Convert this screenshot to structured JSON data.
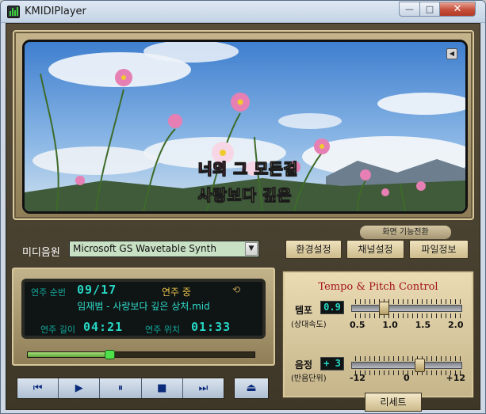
{
  "window": {
    "title": "KMIDIPlayer",
    "minimize_glyph": "—",
    "maximize_glyph": "□",
    "close_glyph": "✕"
  },
  "video": {
    "lyric_line1_sung": "너의 그",
    "lyric_line1_rest": " 모든걸",
    "lyric_line2": "사랑보다 깊은",
    "screen_toggle_label": "화면 기능전환",
    "corner_icon": "back-arrow-icon"
  },
  "source": {
    "label": "미디음원",
    "selected": "Microsoft GS Wavetable Synth",
    "buttons": {
      "env": "환경설정",
      "channel": "채널설정",
      "fileinfo": "파일정보"
    }
  },
  "player": {
    "order_label": "연주 순번",
    "order_value": "09/17",
    "state": "연주 중",
    "filename": "임재범 - 사랑보다 깊은 상처.mid",
    "length_label": "연주 길이",
    "length_value": "04:21",
    "position_label": "연주 위치",
    "position_value": "01:33",
    "progress_fraction": 0.36,
    "transport": {
      "prev": "⏮",
      "play": "▶",
      "pause": "⏸",
      "stop": "■",
      "next": "⏭",
      "eject": "⏏"
    }
  },
  "tempo_pitch": {
    "title": "Tempo & Pitch Control",
    "tempo_label": "템포",
    "tempo_sub": "(상대속도)",
    "tempo_value": "0.9",
    "tempo_scale": [
      "0.5",
      "1.0",
      "1.5",
      "2.0"
    ],
    "tempo_min": 0.5,
    "tempo_max": 2.0,
    "tempo_current": 0.9,
    "pitch_label": "음정",
    "pitch_sub": "(반음단위)",
    "pitch_value": "+ 3",
    "pitch_scale": [
      "-12",
      "0",
      "+12"
    ],
    "pitch_min": -12,
    "pitch_max": 12,
    "pitch_current": 3,
    "reset_label": "리세트"
  },
  "colors": {
    "lcd_text": "#26d7c4",
    "lcd_state": "#e8c24a",
    "lyric_sung": "#f03c8e",
    "lyric_unsung": "#d7c79b",
    "lyric_line2": "#c9e07c",
    "title_red": "#a3121b"
  }
}
